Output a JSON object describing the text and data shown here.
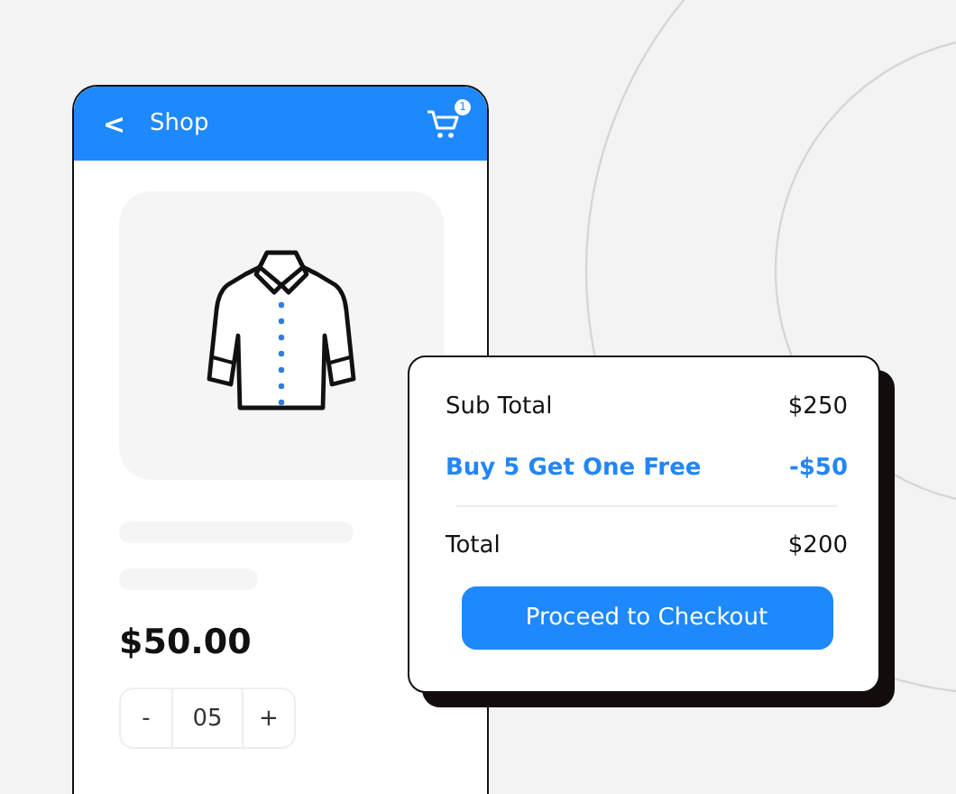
{
  "header": {
    "back": "<",
    "title": "Shop",
    "cart_badge": "1"
  },
  "product": {
    "price": "$50.00",
    "quantity": {
      "minus": "-",
      "value": "05",
      "plus": "+"
    }
  },
  "summary": {
    "rows": [
      {
        "kind": "normal",
        "label": "Sub Total",
        "amount": "$250"
      },
      {
        "kind": "discount",
        "label": "Buy 5 Get One Free",
        "amount": "-$50"
      },
      {
        "kind": "total",
        "label": "Total",
        "amount": "$200"
      }
    ],
    "button": "Proceed to Checkout"
  }
}
